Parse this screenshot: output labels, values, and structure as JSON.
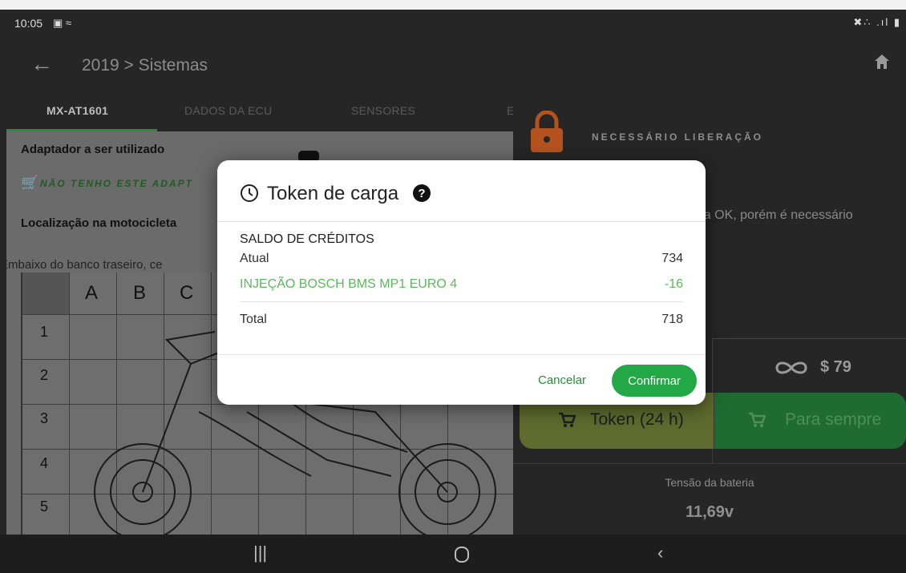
{
  "status_bar": {
    "time": "10:05",
    "left_icons": "image-icon, wavy-icon",
    "right_icons": "mute, wifi, signal, battery"
  },
  "app_bar": {
    "breadcrumb": "2019 > Sistemas"
  },
  "tabs": [
    {
      "label": "MX-AT1601",
      "active": true
    },
    {
      "label": "DADOS DA ECU",
      "active": false
    },
    {
      "label": "SENSORES",
      "active": false
    },
    {
      "label": "E",
      "active": false
    }
  ],
  "left_panel": {
    "adapter_heading": "Adaptador a ser utilizado",
    "adapter_missing": "NÃO TENHO ESTE ADAPT",
    "location_heading": "Localização na motocicleta",
    "location_desc": "Embaixo do banco traseiro, ce",
    "grid_columns": [
      "A",
      "B",
      "C"
    ],
    "grid_rows": [
      "1",
      "2",
      "3",
      "4",
      "5"
    ]
  },
  "right_panel": {
    "lock_title": "NECESSÁRIO LIBERAÇÃO",
    "lock_text": "eria OK, porém é necessário",
    "price_forever": "$ 79",
    "btn_token": "Token (24 h)",
    "btn_forever": "Para sempre",
    "battery_label": "Tensão da bateria",
    "battery_value": "11,69v"
  },
  "dialog": {
    "title": "Token de carga",
    "section": "SALDO DE CRÉDITOS",
    "rows": [
      {
        "label": "Atual",
        "value": "734"
      },
      {
        "label": "INJEÇÃO BOSCH BMS MP1 EURO 4",
        "value": "-16"
      },
      {
        "label": "Total",
        "value": "718"
      }
    ],
    "cancel_label": "Cancelar",
    "confirm_label": "Confirmar"
  },
  "colors": {
    "accent_green": "#22a845",
    "deduction_green": "#5cb85c",
    "lock_orange": "#b5531f"
  }
}
